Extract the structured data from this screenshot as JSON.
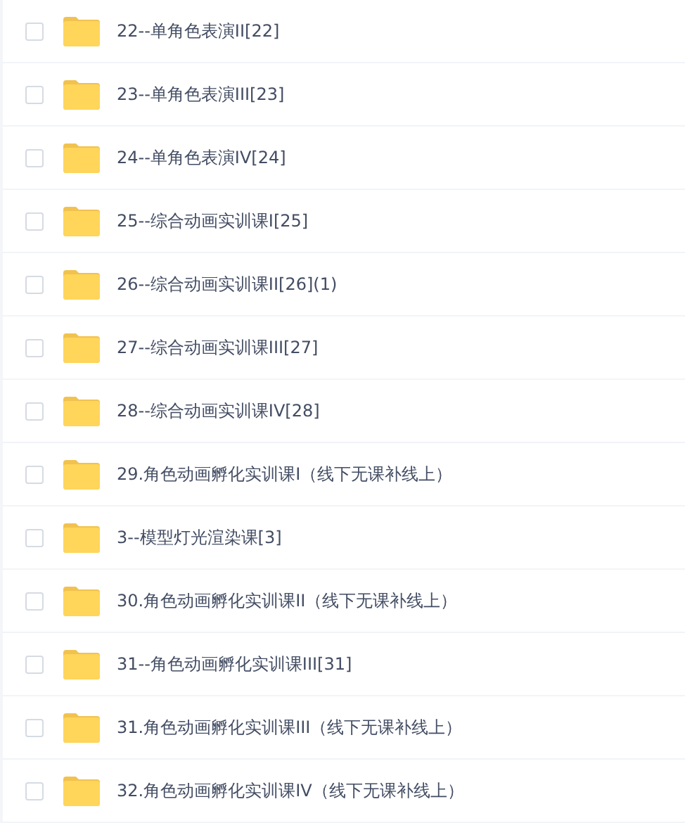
{
  "files": [
    {
      "name": "22--单角色表演II[22]",
      "checked": false
    },
    {
      "name": "23--单角色表演III[23]",
      "checked": false
    },
    {
      "name": "24--单角色表演IV[24]",
      "checked": false
    },
    {
      "name": "25--综合动画实训课I[25]",
      "checked": false
    },
    {
      "name": "26--综合动画实训课II[26](1)",
      "checked": false
    },
    {
      "name": "27--综合动画实训课III[27]",
      "checked": false
    },
    {
      "name": "28--综合动画实训课IV[28]",
      "checked": false
    },
    {
      "name": "29.角色动画孵化实训课I（线下无课补线上）",
      "checked": false
    },
    {
      "name": "3--模型灯光渲染课[3]",
      "checked": false
    },
    {
      "name": "30.角色动画孵化实训课II（线下无课补线上）",
      "checked": false
    },
    {
      "name": "31--角色动画孵化实训课III[31]",
      "checked": false
    },
    {
      "name": "31.角色动画孵化实训课III（线下无课补线上）",
      "checked": false
    },
    {
      "name": "32.角色动画孵化实训课IV（线下无课补线上）",
      "checked": false
    }
  ]
}
